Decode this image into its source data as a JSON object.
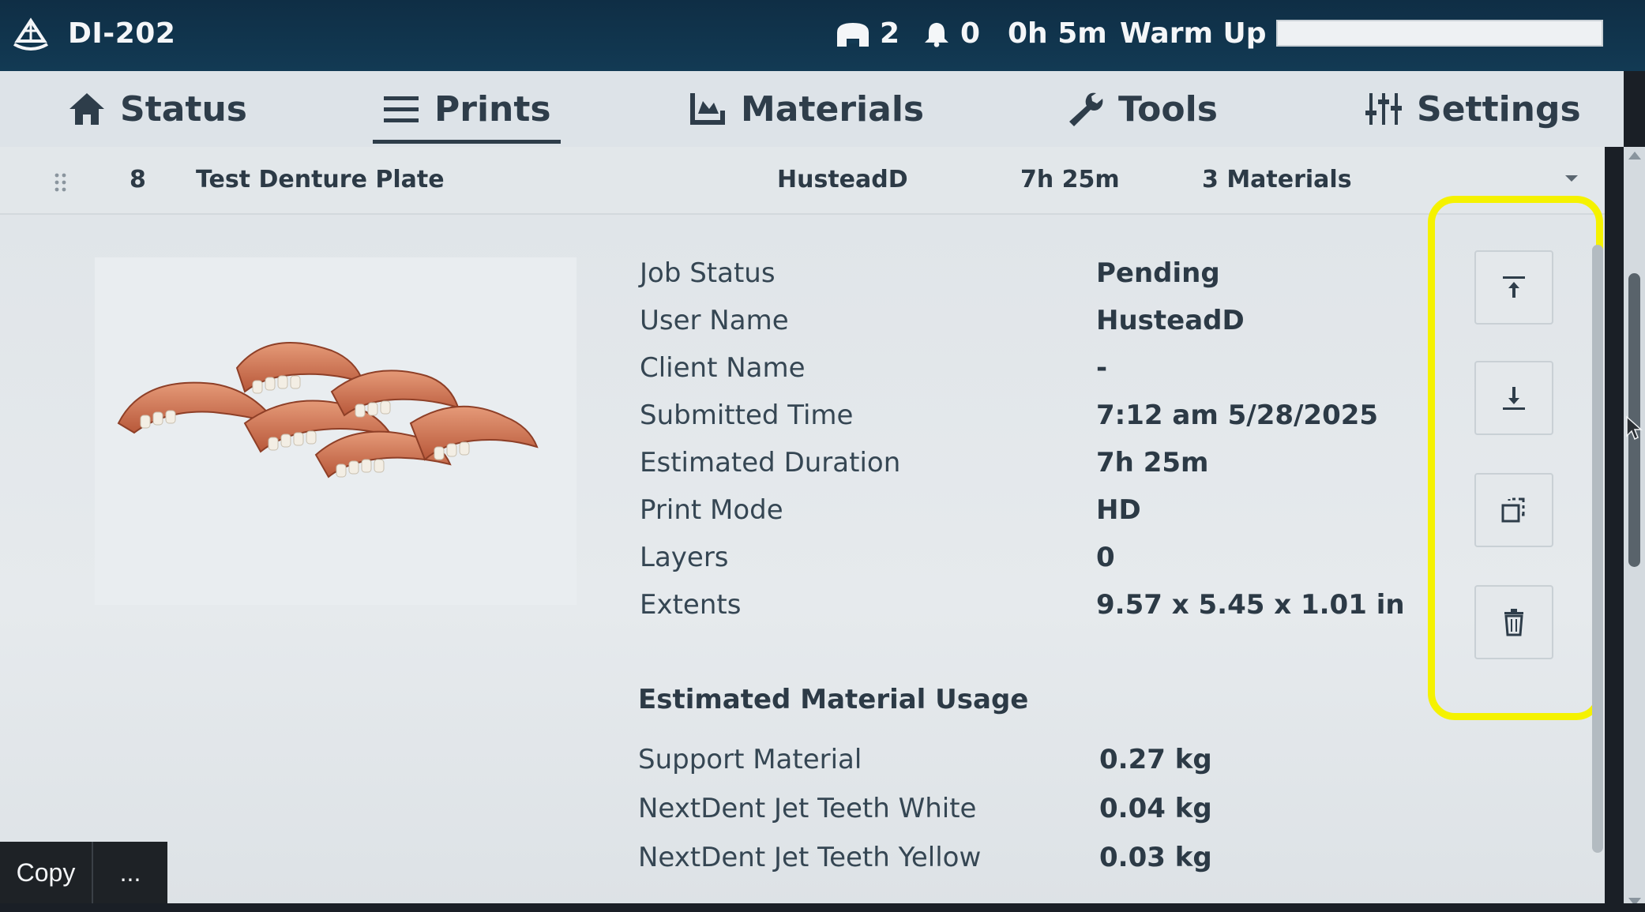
{
  "topbar": {
    "device_name": "DI-202",
    "queue_count": "2",
    "notification_count": "0",
    "elapsed_time": "0h 5m",
    "printer_state": "Warm Up",
    "progress_fraction": 0.0
  },
  "nav": {
    "tabs": [
      {
        "label": "Status",
        "icon": "home-icon"
      },
      {
        "label": "Prints",
        "icon": "menu-icon",
        "active": true
      },
      {
        "label": "Materials",
        "icon": "tray-icon"
      },
      {
        "label": "Tools",
        "icon": "wrench-icon"
      },
      {
        "label": "Settings",
        "icon": "sliders-icon"
      }
    ]
  },
  "job_row": {
    "number": "8",
    "name": "Test Denture Plate",
    "user": "HusteadD",
    "duration": "7h 25m",
    "materials": "3 Materials"
  },
  "details": [
    {
      "label": "Job Status",
      "value": "Pending"
    },
    {
      "label": "User Name",
      "value": "HusteadD"
    },
    {
      "label": "Client Name",
      "value": "-"
    },
    {
      "label": "Submitted Time",
      "value": "7:12 am 5/28/2025"
    },
    {
      "label": "Estimated Duration",
      "value": "7h 25m"
    },
    {
      "label": "Print Mode",
      "value": "HD"
    },
    {
      "label": "Layers",
      "value": "0"
    },
    {
      "label": "Extents",
      "value": "9.57 x 5.45 x 1.01 in"
    }
  ],
  "usage": {
    "title": "Estimated Material Usage",
    "items": [
      {
        "label": "Support Material",
        "value": "0.27 kg"
      },
      {
        "label": "NextDent Jet Teeth White",
        "value": "0.04 kg"
      },
      {
        "label": "NextDent Jet Teeth Yellow",
        "value": "0.03 kg"
      }
    ]
  },
  "actions": [
    "move-to-top-icon",
    "move-to-bottom-icon",
    "duplicate-icon",
    "trash-icon"
  ],
  "highlight_color": "#f5f200",
  "copy_bar": {
    "copy_label": "Copy",
    "more_label": "..."
  }
}
